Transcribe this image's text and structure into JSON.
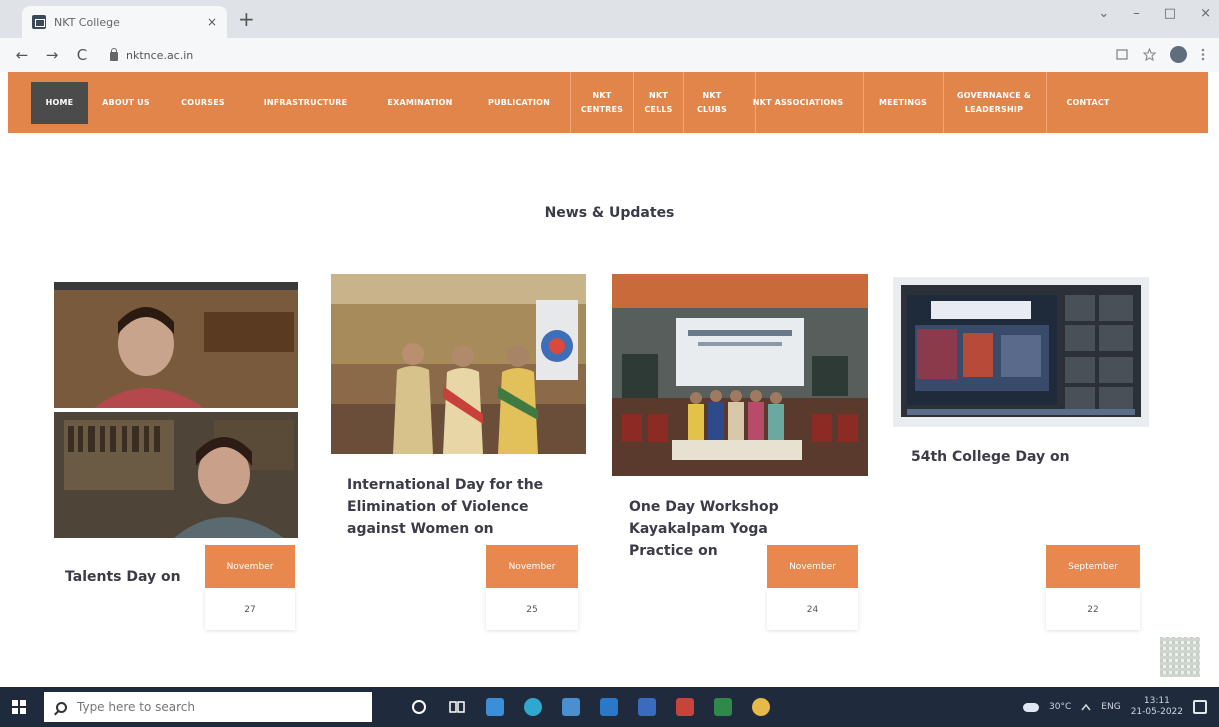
{
  "browser": {
    "tab_title": "NKT College",
    "url": "nktnce.ac.in",
    "tab_close": "×",
    "new_tab": "+",
    "back": "←",
    "forward": "→",
    "reload": "C",
    "window_controls": {
      "chevron": "⌄",
      "minimize": "–",
      "maximize": "□",
      "close": "×"
    }
  },
  "nav": {
    "items": [
      {
        "label": "HOME"
      },
      {
        "label": "ABOUT US"
      },
      {
        "label": "COURSES"
      },
      {
        "label": "INFRASTRUCTURE"
      },
      {
        "label": "EXAMINATION"
      },
      {
        "label": "PUBLICATION"
      },
      {
        "label": "NKT CENTRES"
      },
      {
        "label": "NKT CELLS"
      },
      {
        "label": "NKT CLUBS"
      },
      {
        "label": "NKT ASSOCIATIONS"
      },
      {
        "label": "MEETINGS"
      },
      {
        "label": "GOVERNANCE & LEADERSHIP"
      },
      {
        "label": "CONTACT"
      }
    ],
    "active_index": 0
  },
  "news": {
    "heading": "News & Updates",
    "cards": [
      {
        "title": "Talents Day on",
        "month": "November",
        "day": "27"
      },
      {
        "title": "International Day for the Elimination of Violence against Women on",
        "month": "November",
        "day": "25"
      },
      {
        "title": "One Day Workshop Kayakalpam Yoga Practice on",
        "month": "November",
        "day": "24"
      },
      {
        "title": "54th College Day on",
        "month": "September",
        "day": "22"
      }
    ]
  },
  "taskbar": {
    "search_placeholder": "Type here to search",
    "temperature": "30°C",
    "language": "ENG",
    "time": "13:11",
    "date": "21-05-2022"
  },
  "colors": {
    "nav_bg": "#e2854a",
    "nav_active": "#4b4b4b",
    "badge_bg": "#e8874e",
    "taskbar_bg": "#1f2a3d"
  }
}
